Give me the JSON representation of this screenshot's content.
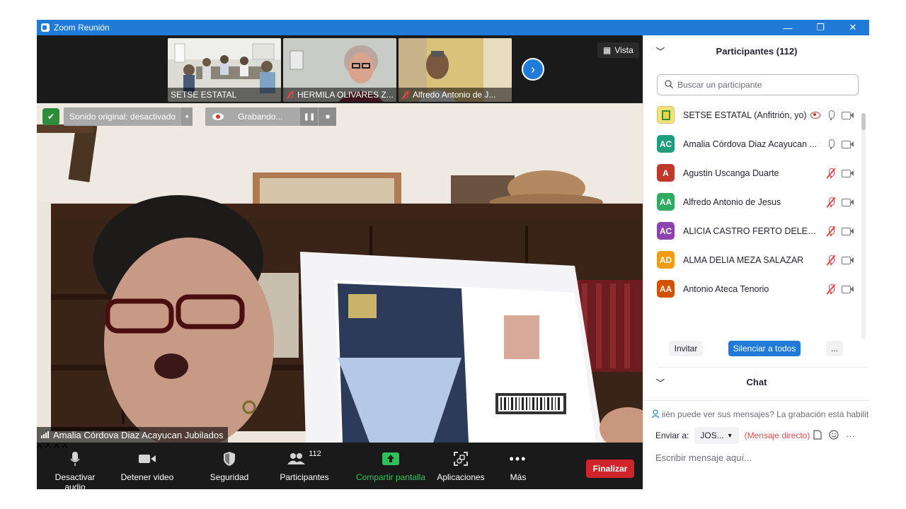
{
  "window": {
    "title": "Zoom Reunión",
    "minimize": "—",
    "restore": "❐",
    "close": "✕"
  },
  "strip": {
    "thumbnails": [
      {
        "label": "SETSE ESTATAL",
        "muted": false
      },
      {
        "label": "HERMILA OLIVARES Z...",
        "muted": true
      },
      {
        "label": "Alfredo Antonio de J...",
        "muted": true
      }
    ],
    "view_label": "Vista"
  },
  "video": {
    "sound_label": "Sonido original: desactivado",
    "recording_label": "Grabando...",
    "active_speaker": "Amalia Córdova Diaz Acayucan Jubilados"
  },
  "toolbar": {
    "mute_label": "Desactivar audio",
    "video_label": "Detener video",
    "security_label": "Seguridad",
    "participants_label": "Participantes",
    "participants_count": "112",
    "share_label": "Compartir pantalla",
    "apps_label": "Aplicaciones",
    "more_label": "Más",
    "end_label": "Finalizar"
  },
  "participants_panel": {
    "title": "Participantes (112)",
    "search_placeholder": "Buscar un participante",
    "items": [
      {
        "initials": "",
        "name": "SETSE ESTATAL (Anfitrión, yo)",
        "color": "#e8d44d",
        "mic": "on",
        "recording": true
      },
      {
        "initials": "AC",
        "name": "Amalia Córdova Diaz Acayucan ...",
        "color": "#1e9e7c",
        "mic": "on"
      },
      {
        "initials": "A",
        "name": "Agustin Uscanga Duarte",
        "color": "#c0392b",
        "mic": "off"
      },
      {
        "initials": "AA",
        "name": "Alfredo Antonio de Jesus",
        "color": "#2eab5e",
        "mic": "off"
      },
      {
        "initials": "AC",
        "name": "ALICIA CASTRO FERTO DELEGAC...",
        "color": "#8e44ad",
        "mic": "off"
      },
      {
        "initials": "AD",
        "name": "ALMA DELIA MEZA SALAZAR",
        "color": "#f39c12",
        "mic": "off"
      },
      {
        "initials": "AA",
        "name": "Antonio Ateca Tenorio",
        "color": "#d35400",
        "mic": "off"
      }
    ],
    "invite_label": "Invitar",
    "mute_all_label": "Silenciar a todos",
    "more_label": "..."
  },
  "chat_panel": {
    "title": "Chat",
    "notice": "iién puede ver sus mensajes? La grabación está habilit",
    "send_to_label": "Enviar a:",
    "recipient": "JOS...",
    "direct_label": "(Mensaje directo)",
    "input_placeholder": "Escribir mensaje aquí..."
  }
}
